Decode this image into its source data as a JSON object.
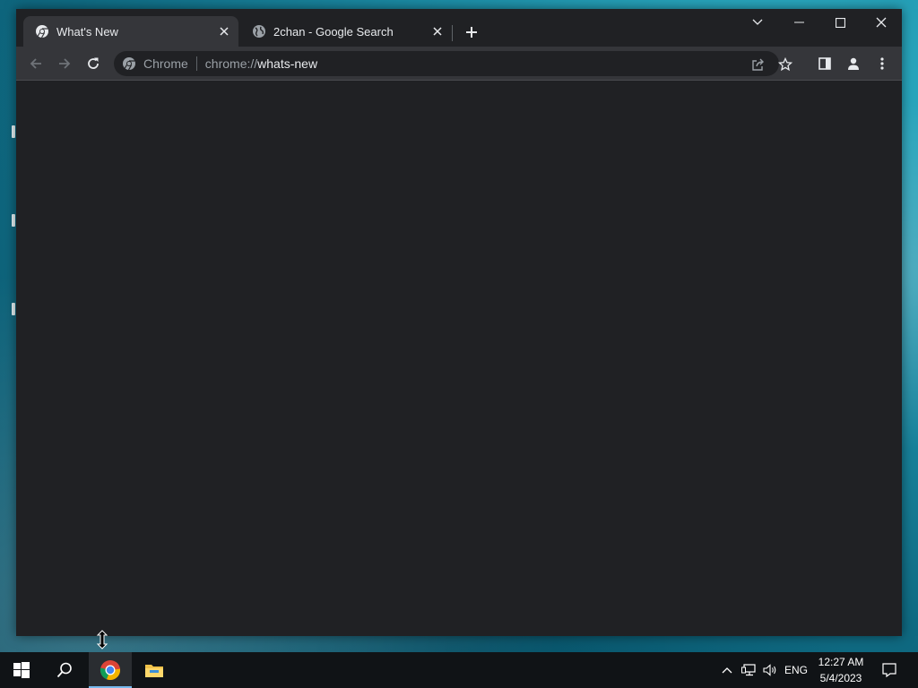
{
  "browser": {
    "tabs": [
      {
        "title": "What's New",
        "active": true,
        "favicon": "chrome-icon"
      },
      {
        "title": "2chan - Google Search",
        "active": false,
        "favicon": "globe-icon"
      }
    ],
    "omnibox": {
      "site_label": "Chrome",
      "url_scheme": "chrome://",
      "url_host": "whats-new"
    }
  },
  "taskbar": {
    "pinned": [
      "start-icon",
      "search-icon",
      "chrome-icon",
      "file-explorer-icon"
    ],
    "tray": {
      "language": "ENG",
      "time": "12:27 AM",
      "date": "5/4/2023"
    }
  },
  "colors": {
    "window_bg": "#202124",
    "toolbar_bg": "#35363a",
    "text": "#e8eaed",
    "muted_text": "#9aa0a6",
    "taskbar_bg": "#101316",
    "taskbar_active_indicator": "#76b9ed"
  }
}
